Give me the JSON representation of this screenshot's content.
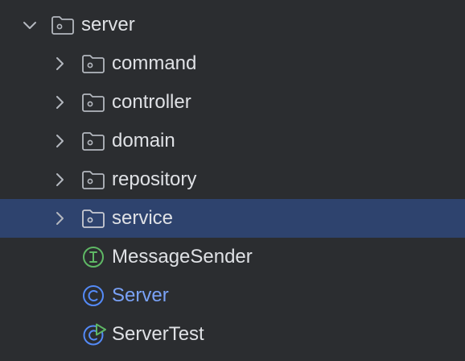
{
  "project_tree": {
    "root": {
      "label": "server",
      "expanded": true,
      "icon": "package-folder-icon"
    },
    "items": [
      {
        "label": "command",
        "type": "package",
        "icon": "package-folder-icon",
        "collapsed": true
      },
      {
        "label": "controller",
        "type": "package",
        "icon": "package-folder-icon",
        "collapsed": true
      },
      {
        "label": "domain",
        "type": "package",
        "icon": "package-folder-icon",
        "collapsed": true
      },
      {
        "label": "repository",
        "type": "package",
        "icon": "package-folder-icon",
        "collapsed": true
      },
      {
        "label": "service",
        "type": "package",
        "icon": "package-folder-icon",
        "collapsed": true,
        "selected": true
      },
      {
        "label": "MessageSender",
        "type": "interface",
        "icon": "interface-icon"
      },
      {
        "label": "Server",
        "type": "class",
        "icon": "class-icon"
      },
      {
        "label": "ServerTest",
        "type": "test-class",
        "icon": "test-class-icon"
      }
    ]
  },
  "colors": {
    "background": "#2b2d30",
    "selection": "#2e436e",
    "text": "#dfe1e5",
    "class_text": "#7aa2f7",
    "interface_icon": "#5fb865",
    "class_icon": "#548af7",
    "test_icon": "#5fb865"
  }
}
